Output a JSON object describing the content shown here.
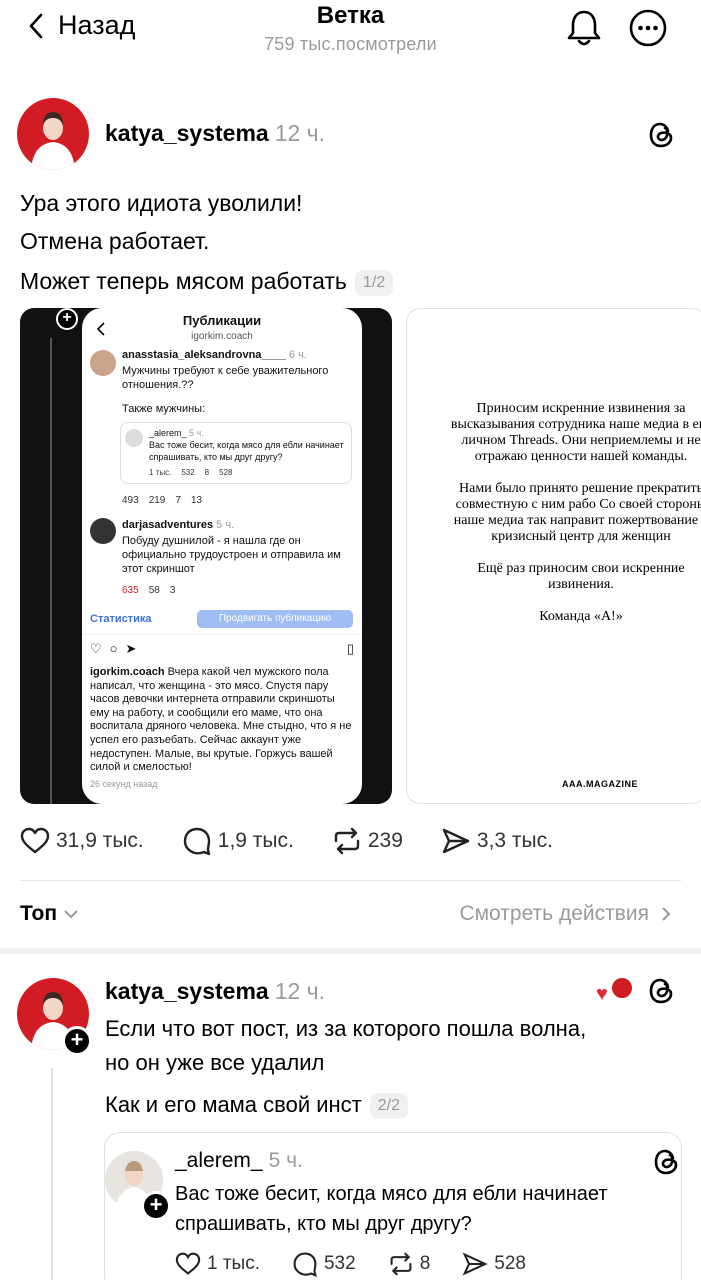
{
  "header": {
    "back_label": "Назад",
    "title": "Ветка",
    "views": "759 тыс.посмотрели"
  },
  "post": {
    "username": "katya_systema",
    "time": "12 ч.",
    "lines": [
      "Ура этого идиота уволили!",
      "Отмена работает.",
      "Может теперь мясом работать"
    ],
    "pager": "1/2",
    "screenshot": {
      "title": "Публикации",
      "subtitle": "igorkim.coach",
      "p1_user": "anasstasia_aleksandrovna____",
      "p1_time": "6 ч.",
      "p1_text": "Мужчины требуют к себе уважительного отношения.??",
      "p1_text2": "Также мужчины:",
      "q_user": "_alerem_",
      "q_time": "5 ч.",
      "q_text": "Вас тоже бесит, когда мясо для ебли начинает спрашивать, кто мы друг другу?",
      "q_stats": [
        "1 тыс.",
        "532",
        "8",
        "528"
      ],
      "p1_stats": [
        "493",
        "219",
        "7",
        "13"
      ],
      "p2_user": "darjasadventures",
      "p2_time": "5 ч.",
      "p2_text": "Побуду душнилой - я нашла где он официально трудоустроен и отправила им этот скриншот",
      "p2_stats": [
        "635",
        "58",
        "3"
      ],
      "stats_link": "Статистика",
      "promote": "Продвигать публикацию",
      "cap_user": "igorkim.coach",
      "caption": "Вчера какой чел мужского пола написал, что женщина - это мясо. Спустя пару часов девочки интернета отправили скриншоты ему на работу, и сообщили его маме, что она воспитала дряного человека. Мне стыдно, что я не успел его разъебать. Сейчас аккаунт уже недоступен. Малые, вы крутые. Горжусь вашей силой и смелостью!",
      "cap_time": "26 секунд назад"
    },
    "apology": {
      "p1": "Приносим искренние извинения за высказывания сотрудника наше медиа в его личном Threads. Они неприемлемы и не отражаю ценности нашей команды.",
      "p2": "Нами было принято решение прекратить совместную с ним рабо Со своей стороны наше медиа так направит пожертвование в кризисный центр для женщин",
      "p3": "Ещё раз приносим свои искренние извинения.",
      "p4": "Команда «А!»",
      "mag": "AAA.MAGAZINE"
    },
    "likes": "31,9 тыс.",
    "comments": "1,9 тыс.",
    "reposts": "239",
    "shares": "3,3 тыс."
  },
  "sort": {
    "label": "Топ",
    "activity": "Смотреть действия"
  },
  "reply": {
    "username": "katya_systema",
    "time": "12 ч.",
    "line1": "Если что вот пост, из за которого пошла волна,",
    "line2": "но он уже все удалил",
    "line3": "Как и его мама свой инст",
    "pager": "2/2",
    "quote": {
      "username": "_alerem_",
      "time": "5 ч.",
      "line1": "Вас тоже бесит, когда мясо для ебли начинает",
      "line2": "спрашивать, кто мы друг другу?",
      "likes": "1 тыс.",
      "comments": "532",
      "reposts": "8",
      "shares": "528"
    }
  },
  "colors": {
    "accent_red": "#d21c24",
    "muted": "#9a9a9a",
    "link_blue": "#3d6fd8"
  }
}
